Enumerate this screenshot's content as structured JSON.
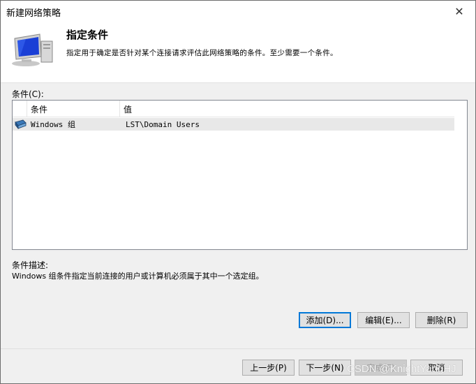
{
  "window": {
    "title": "新建网络策略",
    "close_glyph": "✕"
  },
  "header": {
    "icon": "monitor-icon",
    "title": "指定条件",
    "description": "指定用于确定是否针对某个连接请求评估此网络策略的条件。至少需要一个条件。"
  },
  "conditions": {
    "label": "条件(C):",
    "columns": [
      "条件",
      "值"
    ],
    "rows": [
      {
        "icon": "windows-group-icon",
        "name": "Windows 组",
        "value": "LST\\Domain Users"
      }
    ]
  },
  "description": {
    "label": "条件描述:",
    "text": "Windows 组条件指定当前连接的用户或计算机必须属于其中一个选定组。"
  },
  "buttons": {
    "add": "添加(D)...",
    "edit": "编辑(E)...",
    "delete": "删除(R)",
    "back": "上一步(P)",
    "next": "下一步(N)",
    "finish": "完成(F)",
    "cancel": "取消"
  },
  "watermark": "CSDN @KnightYangHJ",
  "colors": {
    "accent": "#0078d7",
    "selected_row": "#e8e8e8"
  }
}
